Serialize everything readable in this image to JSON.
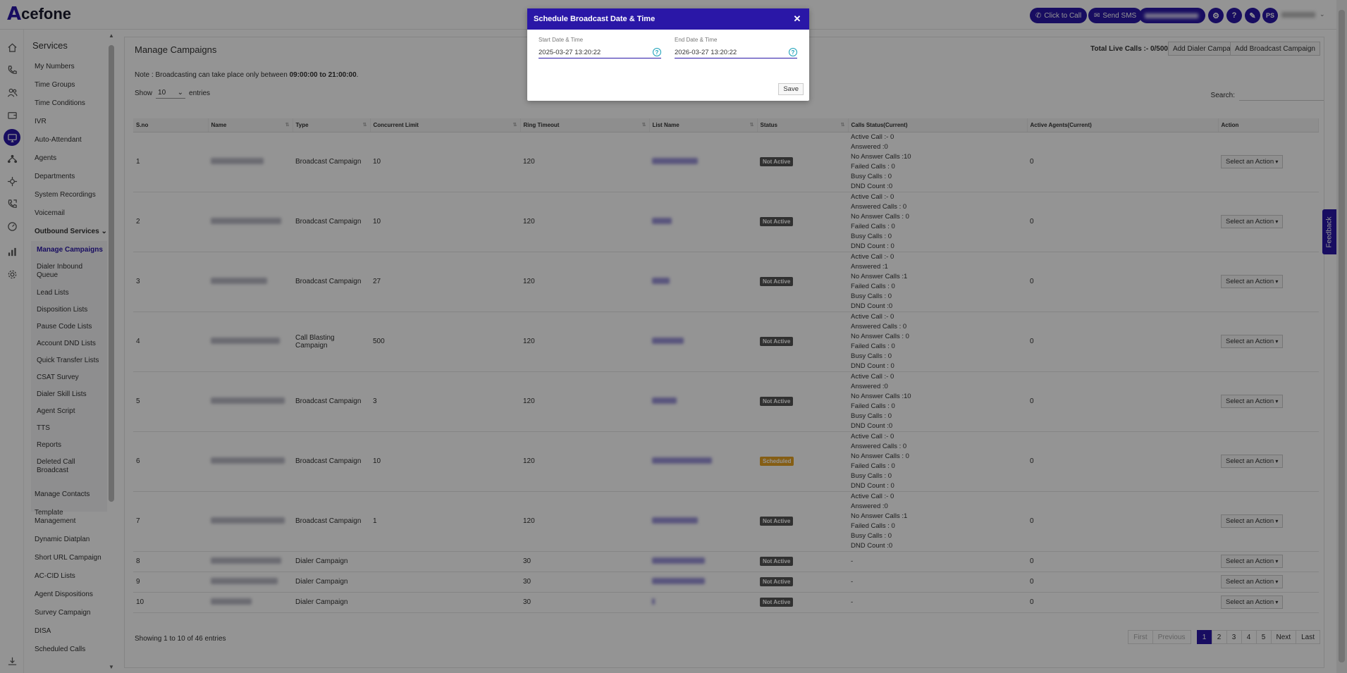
{
  "app": {
    "logo_text": "cefone",
    "logo_mark": "A"
  },
  "topbar": {
    "click_to_call": "Click to Call",
    "send_sms": "Send SMS",
    "avatar_initials": "PS"
  },
  "rail": {
    "icons": [
      "home-icon",
      "phone-icon",
      "users-icon",
      "wallet-icon",
      "monitor-icon",
      "network-icon",
      "plug-icon",
      "call-forward-icon",
      "gauge-icon",
      "bar-chart-icon",
      "gear-icon",
      "download-icon"
    ],
    "active": "monitor-icon"
  },
  "services": {
    "title": "Services",
    "items_top": [
      "My Numbers",
      "Time Groups",
      "Time Conditions",
      "IVR",
      "Auto-Attendant",
      "Agents",
      "Departments",
      "System Recordings",
      "Voicemail"
    ],
    "outbound_label": "Outbound Services",
    "sub_items": [
      "Manage Campaigns",
      "Dialer Inbound Queue",
      "Lead Lists",
      "Disposition Lists",
      "Pause Code Lists",
      "Account DND Lists",
      "Quick Transfer Lists",
      "CSAT Survey",
      "Dialer Skill Lists",
      "Agent Script",
      "TTS",
      "Reports",
      "Deleted Call Broadcast"
    ],
    "items_bottom": [
      "Manage Contacts",
      "Template Management",
      "Dynamic Diatplan",
      "Short URL Campaign",
      "AC-CID Lists",
      "Agent Dispositions",
      "Survey Campaign",
      "DISA",
      "Scheduled Calls"
    ]
  },
  "main": {
    "title": "Manage Campaigns",
    "total_live_calls": "Total Live Calls :- 0/500",
    "add_dialer": "Add Dialer Campaign",
    "add_broadcast": "Add Broadcast Campaign",
    "note_prefix": "Note : Broadcasting can take place only between ",
    "note_bold": "09:00:00 to 21:00:00",
    "note_suffix": ".",
    "show_label": "Show",
    "show_value": "10",
    "entries_label": "entries",
    "search_label": "Search:",
    "showing": "Showing 1 to 10 of 46 entries"
  },
  "table": {
    "columns": [
      "S.no",
      "Name",
      "Type",
      "Concurrent Limit",
      "Ring Timeout",
      "List Name",
      "Status",
      "Calls Status(Current)",
      "Active Agents(Current)",
      "Action"
    ],
    "action_label": "Select an Action",
    "rows": [
      {
        "sno": "1",
        "type": "Broadcast Campaign",
        "limit": "10",
        "timeout": "120",
        "status": "Not Active",
        "calls": [
          "Active Call :- 0",
          "Answered :0",
          "No Answer Calls :10",
          "Failed Calls : 0",
          "Busy Calls : 0",
          "DND Count :0"
        ],
        "agents": "0"
      },
      {
        "sno": "2",
        "type": "Broadcast Campaign",
        "limit": "10",
        "timeout": "120",
        "status": "Not Active",
        "calls": [
          "Active Call :- 0",
          "Answered Calls : 0",
          "No Answer Calls : 0",
          "Failed Calls : 0",
          "Busy Calls : 0",
          "DND Count : 0"
        ],
        "agents": "0"
      },
      {
        "sno": "3",
        "type": "Broadcast Campaign",
        "limit": "27",
        "timeout": "120",
        "status": "Not Active",
        "calls": [
          "Active Call :- 0",
          "Answered :1",
          "No Answer Calls :1",
          "Failed Calls : 0",
          "Busy Calls : 0",
          "DND Count :0"
        ],
        "agents": "0"
      },
      {
        "sno": "4",
        "type": "Call Blasting Campaign",
        "limit": "500",
        "timeout": "120",
        "status": "Not Active",
        "calls": [
          "Active Call :- 0",
          "Answered Calls : 0",
          "No Answer Calls : 0",
          "Failed Calls : 0",
          "Busy Calls : 0",
          "DND Count : 0"
        ],
        "agents": "0"
      },
      {
        "sno": "5",
        "type": "Broadcast Campaign",
        "limit": "3",
        "timeout": "120",
        "status": "Not Active",
        "calls": [
          "Active Call :- 0",
          "Answered :0",
          "No Answer Calls :10",
          "Failed Calls : 0",
          "Busy Calls : 0",
          "DND Count :0"
        ],
        "agents": "0"
      },
      {
        "sno": "6",
        "type": "Broadcast Campaign",
        "limit": "10",
        "timeout": "120",
        "status": "Scheduled",
        "calls": [
          "Active Call :- 0",
          "Answered Calls : 0",
          "No Answer Calls : 0",
          "Failed Calls : 0",
          "Busy Calls : 0",
          "DND Count : 0"
        ],
        "agents": "0"
      },
      {
        "sno": "7",
        "type": "Broadcast Campaign",
        "limit": "1",
        "timeout": "120",
        "status": "Not Active",
        "calls": [
          "Active Call :- 0",
          "Answered :0",
          "No Answer Calls :1",
          "Failed Calls : 0",
          "Busy Calls : 0",
          "DND Count :0"
        ],
        "agents": "0"
      },
      {
        "sno": "8",
        "type": "Dialer Campaign",
        "limit": "",
        "timeout": "30",
        "status": "Not Active",
        "calls": [
          "-"
        ],
        "agents": "0"
      },
      {
        "sno": "9",
        "type": "Dialer Campaign",
        "limit": "",
        "timeout": "30",
        "status": "Not Active",
        "calls": [
          "-"
        ],
        "agents": "0"
      },
      {
        "sno": "10",
        "type": "Dialer Campaign",
        "limit": "",
        "timeout": "30",
        "status": "Not Active",
        "calls": [
          "-"
        ],
        "agents": "0"
      }
    ]
  },
  "pager": {
    "first": "First",
    "previous": "Previous",
    "pages": [
      "1",
      "2",
      "3",
      "4",
      "5"
    ],
    "active_page": "1",
    "next": "Next",
    "last": "Last"
  },
  "feedback": "Feedback",
  "modal": {
    "title": "Schedule Broadcast Date & Time",
    "start_label": "Start Date & Time",
    "start_value": "2025-03-27 13:20:22",
    "end_label": "End Date & Time",
    "end_value": "2026-03-27 13:20:22",
    "save": "Save",
    "help_glyph": "?"
  },
  "colors": {
    "brand": "#2a17a7",
    "scheduled": "#e6a224",
    "not_active": "#555555",
    "help": "#1aa0b8"
  }
}
